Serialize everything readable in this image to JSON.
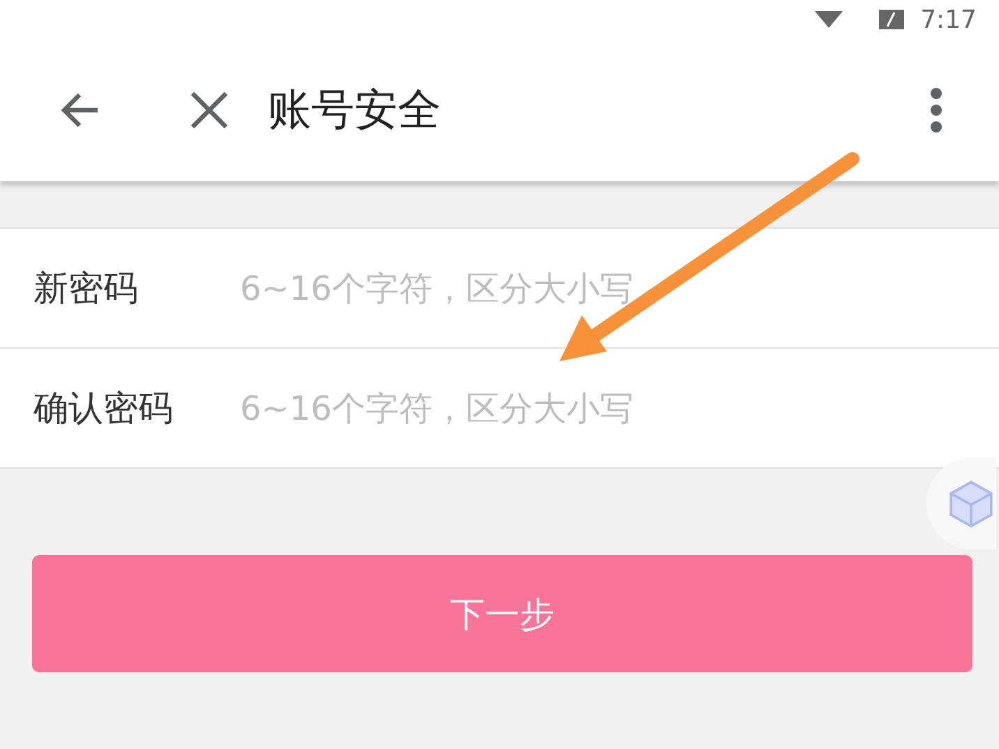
{
  "status_bar": {
    "time": "7:17"
  },
  "toolbar": {
    "title": "账号安全"
  },
  "form": {
    "fields": [
      {
        "label": "新密码",
        "placeholder": "6~16个字符，区分大小写"
      },
      {
        "label": "确认密码",
        "placeholder": "6~16个字符，区分大小写"
      }
    ]
  },
  "next_button": {
    "label": "下一步"
  }
}
